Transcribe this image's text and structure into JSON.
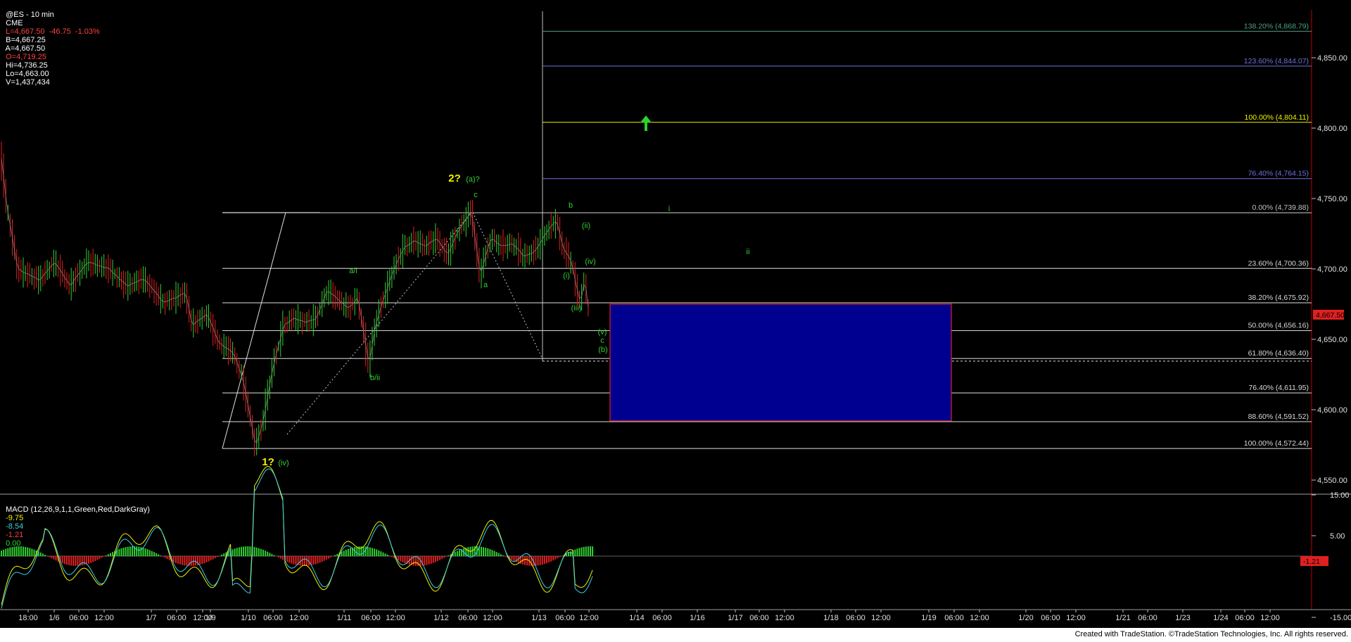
{
  "header": {
    "symbol": "@ES - 10 min",
    "exchange": "CME",
    "quote": "L=4,667.50  -46.75  -1.03%",
    "bid": "B=4,667.25",
    "ask": "A=4,667.50",
    "open": "O=4,719.25",
    "high": "Hi=4,736.25",
    "low": "Lo=4,663.00",
    "volume": "V=1,437,434"
  },
  "footer": {
    "credit": "Created with TradeStation. ©TradeStation Technologies, Inc. All rights reserved."
  },
  "colors": {
    "background": "#000000",
    "up": "#2fd12f",
    "down": "#e02020",
    "fib": "#d0d0d0",
    "box": "#000090",
    "box_border": "#e02020",
    "yellow": "#f2f200",
    "green": "#2fd12f"
  },
  "chart_data": [
    {
      "type": "candlestick",
      "title": "@ES - 10 min",
      "ylim": [
        4535,
        4880
      ],
      "y_ticks": [
        "4,850.00",
        "4,800.00",
        "4,750.00",
        "4,700.00",
        "4,650.00",
        "4,600.00",
        "4,550.00"
      ],
      "y_tick_values": [
        4850,
        4800,
        4750,
        4700,
        4650,
        4600,
        4550
      ],
      "last_price": "4,667.50",
      "x_ticks": [
        "18:00",
        "1/6",
        "06:00",
        "12:00",
        "1/7",
        "06:00",
        "12:00",
        "1/9",
        "1/10",
        "06:00",
        "12:00",
        "1/11",
        "06:00",
        "12:00",
        "1/12",
        "06:00",
        "12:00",
        "1/13",
        "06:00",
        "12:00",
        "1/14",
        "06:00",
        "1/16",
        "1/17",
        "06:00",
        "12:00",
        "1/18",
        "06:00",
        "12:00",
        "1/19",
        "06:00",
        "12:00",
        "1/20",
        "06:00",
        "12:00",
        "1/21",
        "06:00",
        "1/23",
        "1/24",
        "06:00",
        "12:00"
      ],
      "price_path": [
        [
          0,
          4785
        ],
        [
          3,
          4745
        ],
        [
          8,
          4700
        ],
        [
          18,
          4692
        ],
        [
          25,
          4705
        ],
        [
          32,
          4688
        ],
        [
          40,
          4705
        ],
        [
          50,
          4700
        ],
        [
          58,
          4688
        ],
        [
          66,
          4693
        ],
        [
          75,
          4676
        ],
        [
          85,
          4683
        ],
        [
          88,
          4660
        ],
        [
          95,
          4668
        ],
        [
          100,
          4648
        ],
        [
          107,
          4640
        ],
        [
          111,
          4623
        ],
        [
          114,
          4600
        ],
        [
          117,
          4574
        ],
        [
          120,
          4588
        ],
        [
          125,
          4630
        ],
        [
          130,
          4660
        ],
        [
          135,
          4665
        ],
        [
          140,
          4662
        ],
        [
          145,
          4665
        ],
        [
          150,
          4685
        ],
        [
          155,
          4678
        ],
        [
          160,
          4672
        ],
        [
          164,
          4680
        ],
        [
          169,
          4632
        ],
        [
          172,
          4660
        ],
        [
          176,
          4680
        ],
        [
          180,
          4698
        ],
        [
          185,
          4715
        ],
        [
          190,
          4720
        ],
        [
          195,
          4716
        ],
        [
          200,
          4722
        ],
        [
          205,
          4710
        ],
        [
          210,
          4727
        ],
        [
          216,
          4741
        ],
        [
          220,
          4696
        ],
        [
          225,
          4722
        ],
        [
          230,
          4716
        ],
        [
          235,
          4718
        ],
        [
          240,
          4709
        ],
        [
          245,
          4712
        ],
        [
          250,
          4725
        ],
        [
          255,
          4735
        ],
        [
          258,
          4715
        ],
        [
          262,
          4705
        ],
        [
          264,
          4688
        ],
        [
          266,
          4676
        ],
        [
          268,
          4693
        ],
        [
          270,
          4667
        ]
      ],
      "fibonacci_levels": [
        {
          "label": "138.20% (4,868.79)",
          "value": 4868.79
        },
        {
          "label": "123.60% (4,844.07)",
          "value": 4844.07
        },
        {
          "label": "100.00% (4,804.11)",
          "value": 4804.11
        },
        {
          "label": "76.40% (4,764.15)",
          "value": 4764.15
        },
        {
          "label": "0.00% (4,739.88)",
          "value": 4739.88
        },
        {
          "label": "23.60% (4,700.36)",
          "value": 4700.36
        },
        {
          "label": "38.20% (4,675.92)",
          "value": 4675.92
        },
        {
          "label": "50.00% (4,656.16)",
          "value": 4656.16
        },
        {
          "label": "61.80% (4,636.40)",
          "value": 4636.4
        },
        {
          "label": "76.40% (4,611.95)",
          "value": 4611.95
        },
        {
          "label": "88.60% (4,591.52)",
          "value": 4591.52
        },
        {
          "label": "100.00% (4,572.44)",
          "value": 4572.44
        }
      ],
      "target_zone": {
        "top": 4675,
        "bottom": 4592
      },
      "wave_labels": [
        {
          "text": "2?",
          "color": "yellow"
        },
        {
          "text": "(a)?",
          "color": "green"
        },
        {
          "text": "c",
          "color": "green"
        },
        {
          "text": "b",
          "color": "green"
        },
        {
          "text": "(ii)",
          "color": "green"
        },
        {
          "text": "(iv)",
          "color": "green"
        },
        {
          "text": "(i)",
          "color": "green"
        },
        {
          "text": "(iii)",
          "color": "green"
        },
        {
          "text": "(v)",
          "color": "green"
        },
        {
          "text": "c",
          "color": "green"
        },
        {
          "text": "(b)",
          "color": "green"
        },
        {
          "text": "a/i",
          "color": "green"
        },
        {
          "text": "a",
          "color": "green"
        },
        {
          "text": "b/ii",
          "color": "green"
        },
        {
          "text": "1?",
          "color": "yellow"
        },
        {
          "text": "(iv)",
          "color": "green"
        },
        {
          "text": "i",
          "color": "green"
        },
        {
          "text": "ii",
          "color": "green"
        }
      ]
    },
    {
      "type": "line",
      "title": "MACD (12,26,9,1,1,Green,Red,DarkGray)",
      "values_text": [
        "-9.75",
        "-8.54",
        "-1.21",
        "0.00"
      ],
      "ylim": [
        -22,
        22
      ],
      "y_ticks": [
        "15.00",
        "5.00",
        "-15.00"
      ],
      "y_tick_values": [
        15,
        5,
        -15
      ],
      "last_value": "-1.21"
    }
  ]
}
